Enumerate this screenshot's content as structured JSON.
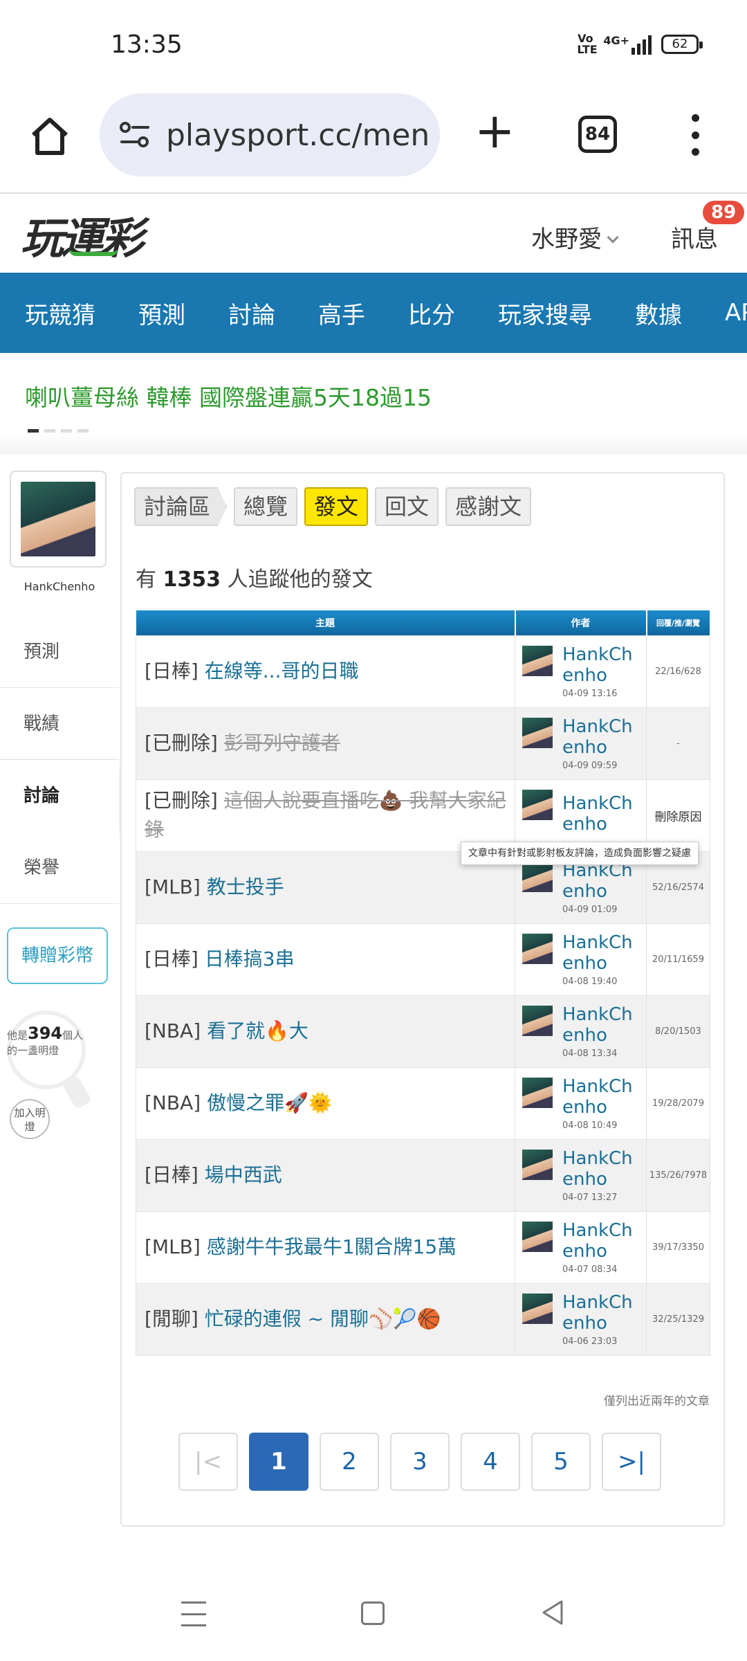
{
  "status": {
    "time": "13:35",
    "volte": "VoLTE",
    "network": "4G+",
    "battery": "62"
  },
  "browser": {
    "url": "playsport.cc/men",
    "tab_count": "84"
  },
  "header": {
    "logo": "玩運彩",
    "username": "水野愛",
    "messages_label": "訊息",
    "messages_badge": "89"
  },
  "nav": {
    "items": [
      "玩競猜",
      "預測",
      "討論",
      "高手",
      "比分",
      "玩家搜尋",
      "數據",
      "APP"
    ]
  },
  "promo": {
    "text": "喇叭薑母絲 韓棒 國際盤連贏5天18過15"
  },
  "sidebar": {
    "name": "HankChenho",
    "items": [
      "預測",
      "戰績",
      "討論",
      "榮譽"
    ],
    "active": "討論",
    "gift_button": "轉贈彩幣",
    "bulb_prefix": "他是",
    "bulb_count": "394",
    "bulb_suffix": "個人",
    "bulb_line2": "的一盞明燈",
    "join_button": "加入明燈"
  },
  "tabs": {
    "crumb": "討論區",
    "overview": "總覽",
    "post": "發文",
    "reply": "回文",
    "thanks": "感謝文"
  },
  "followers": {
    "prefix": "有",
    "count": "1353",
    "suffix": "人追蹤他的發文"
  },
  "table": {
    "headers": {
      "topic": "主題",
      "author": "作者",
      "stats": "回覆/推/瀏覽"
    },
    "rows": [
      {
        "tag": "[日棒]",
        "title": "在線等...哥的日職",
        "deleted": false,
        "author": "HankChenho",
        "time": "04-09 13:16",
        "stats": "22/16/628"
      },
      {
        "tag": "[已刪除]",
        "title": "彭哥列守護者",
        "deleted": true,
        "author": "HankChenho",
        "time": "04-09 09:59",
        "stats": "-"
      },
      {
        "tag": "[已刪除]",
        "title": "這個人說要直播吃💩 我幫大家紀錄",
        "deleted": true,
        "author": "HankChenho",
        "time": "",
        "stats": "刪除原因"
      },
      {
        "tag": "[MLB]",
        "title": "教士投手",
        "deleted": false,
        "author": "HankChenho",
        "time": "04-09 01:09",
        "stats": "52/16/2574"
      },
      {
        "tag": "[日棒]",
        "title": "日棒搞3串",
        "deleted": false,
        "author": "HankChenho",
        "time": "04-08 19:40",
        "stats": "20/11/1659"
      },
      {
        "tag": "[NBA]",
        "title": "看了就🔥大",
        "deleted": false,
        "author": "HankChenho",
        "time": "04-08 13:34",
        "stats": "8/20/1503"
      },
      {
        "tag": "[NBA]",
        "title": "傲慢之罪🚀🌞",
        "deleted": false,
        "author": "HankChenho",
        "time": "04-08 10:49",
        "stats": "19/28/2079"
      },
      {
        "tag": "[日棒]",
        "title": "場中西武",
        "deleted": false,
        "author": "HankChenho",
        "time": "04-07 13:27",
        "stats": "135/26/7978"
      },
      {
        "tag": "[MLB]",
        "title": "感謝牛牛我最牛1關合牌15萬",
        "deleted": false,
        "author": "HankChenho",
        "time": "04-07 08:34",
        "stats": "39/17/3350"
      },
      {
        "tag": "[閒聊]",
        "title": "忙碌的連假 ~ 閒聊⚾🎾🏀",
        "deleted": false,
        "author": "HankChenho",
        "time": "04-06 23:03",
        "stats": "32/25/1329"
      }
    ]
  },
  "tooltip": {
    "text": "文章中有針對或影射板友評論，造成負面影響之疑慮"
  },
  "note": "僅列出近兩年的文章",
  "pager": {
    "first": "|<",
    "pages": [
      "1",
      "2",
      "3",
      "4",
      "5"
    ],
    "last": ">|",
    "current": "1"
  }
}
